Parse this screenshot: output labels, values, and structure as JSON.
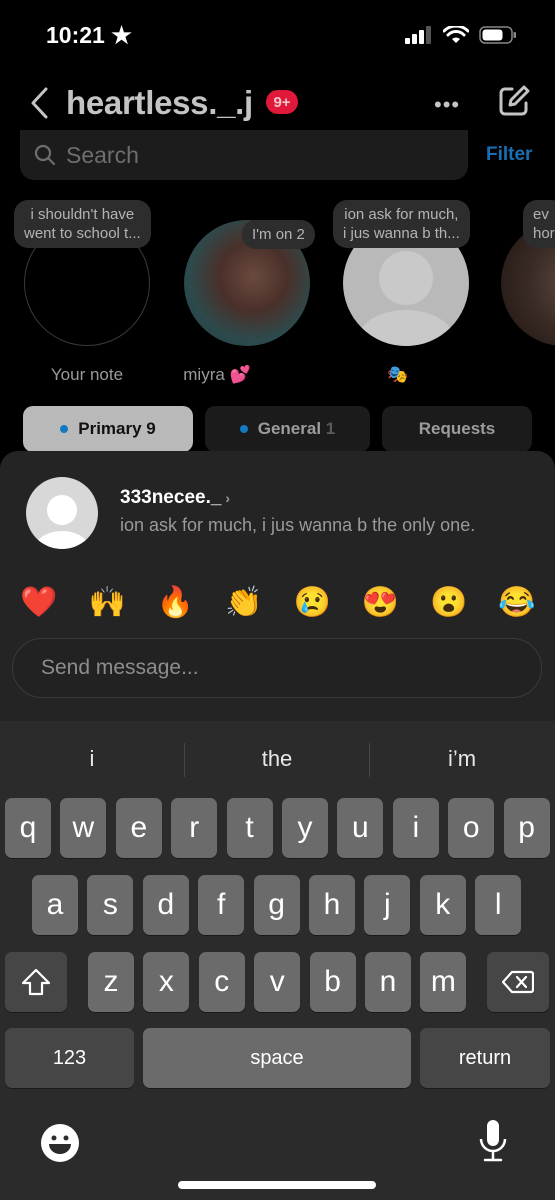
{
  "status_bar": {
    "time": "10:21",
    "time_icon": "star-icon",
    "signal_icon": "cellular-signal-icon",
    "wifi_icon": "wifi-icon",
    "battery_icon": "battery-icon"
  },
  "header": {
    "title": "heartless._.j",
    "badge": "9+",
    "more_icon": "more-horizontal-icon",
    "compose_icon": "compose-icon"
  },
  "search": {
    "placeholder": "Search",
    "filter_label": "Filter"
  },
  "notes": [
    {
      "label": "Your note",
      "bubble": "i shouldn't have\nwent to school t..."
    },
    {
      "label": "miyra 💕",
      "bubble": "I'm on 2"
    },
    {
      "label": "🎭",
      "bubble": "ion ask for much,\ni jus wanna b th..."
    },
    {
      "label": "",
      "bubble": "ev\nhor"
    }
  ],
  "tabs": [
    {
      "label": "Primary",
      "count": "9",
      "dot": true,
      "active": true
    },
    {
      "label": "General",
      "count": "1",
      "dot": true,
      "active": false
    },
    {
      "label": "Requests",
      "count": "",
      "dot": false,
      "active": false
    }
  ],
  "reply": {
    "username": "333necee._",
    "chevron": "›",
    "note_text": "ion ask for much, i jus wanna b the only one.",
    "reactions": [
      "❤️",
      "🙌",
      "🔥",
      "👏",
      "😢",
      "😍",
      "😮",
      "😂"
    ],
    "input_placeholder": "Send message..."
  },
  "keyboard": {
    "suggestions": [
      "i",
      "the",
      "i’m"
    ],
    "row1": [
      "q",
      "w",
      "e",
      "r",
      "t",
      "y",
      "u",
      "i",
      "o",
      "p"
    ],
    "row2": [
      "a",
      "s",
      "d",
      "f",
      "g",
      "h",
      "j",
      "k",
      "l"
    ],
    "row3": [
      "z",
      "x",
      "c",
      "v",
      "b",
      "n",
      "m"
    ],
    "numbers_label": "123",
    "space_label": "space",
    "return_label": "return"
  }
}
